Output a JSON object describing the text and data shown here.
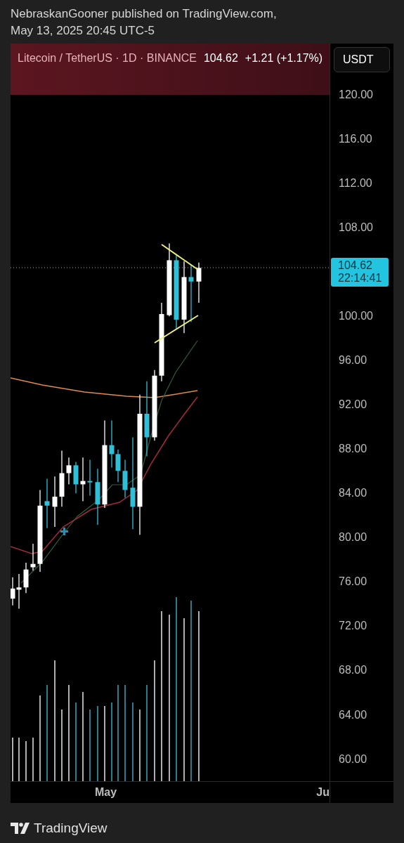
{
  "attribution": {
    "lines": [
      "NebraskanGooner published on TradingView.com,",
      "May 13, 2025 20:45 UTC-5"
    ]
  },
  "symbol_header": {
    "title": "Litecoin / TetherUS · 1D · BINANCE",
    "price": "104.62",
    "change": "+1.21 (+1.17%)"
  },
  "currency_button": "USDT",
  "price_axis_upper": [
    "120.00",
    "116.00",
    "112.00",
    "108.00"
  ],
  "last_price": {
    "price": "104.62",
    "countdown": "22:14:41"
  },
  "price_axis_lower": [
    "100.00",
    "96.00",
    "92.00",
    "88.00",
    "84.00",
    "80.00",
    "76.00",
    "72.00",
    "68.00",
    "64.00",
    "60.00"
  ],
  "time_axis": [
    "May",
    "Ju"
  ],
  "footer": {
    "brand": "TradingView"
  }
}
